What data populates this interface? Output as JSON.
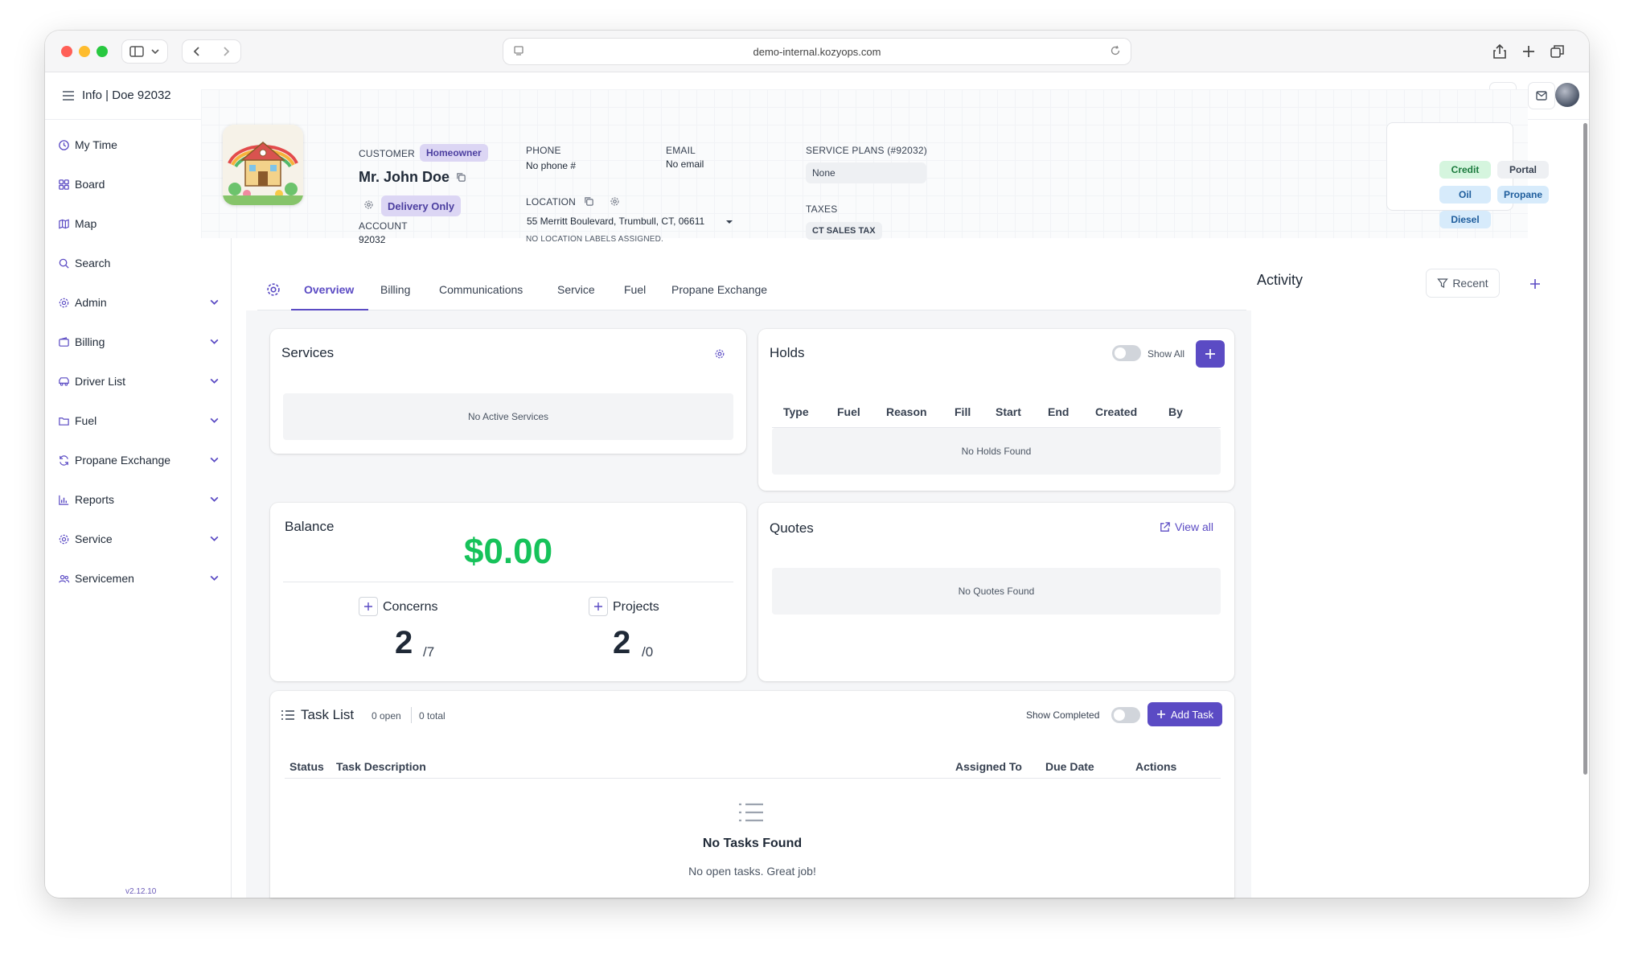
{
  "browser": {
    "url": "demo-internal.kozyops.com"
  },
  "topbar": {
    "breadcrumb": "Info | Doe 92032"
  },
  "sidebar": {
    "items": [
      {
        "label": "My Time",
        "icon": "clock-icon",
        "expandable": false
      },
      {
        "label": "Board",
        "icon": "grid-icon",
        "expandable": false
      },
      {
        "label": "Map",
        "icon": "map-icon",
        "expandable": false
      },
      {
        "label": "Search",
        "icon": "search-icon",
        "expandable": false
      },
      {
        "label": "Admin",
        "icon": "gear-icon",
        "expandable": true
      },
      {
        "label": "Billing",
        "icon": "wallet-icon",
        "expandable": true
      },
      {
        "label": "Driver List",
        "icon": "truck-icon",
        "expandable": true
      },
      {
        "label": "Fuel",
        "icon": "folder-icon",
        "expandable": true
      },
      {
        "label": "Propane Exchange",
        "icon": "refresh-icon",
        "expandable": true
      },
      {
        "label": "Reports",
        "icon": "bar-chart-icon",
        "expandable": true
      },
      {
        "label": "Service",
        "icon": "gear-icon",
        "expandable": true
      },
      {
        "label": "Servicemen",
        "icon": "users-icon",
        "expandable": true
      }
    ],
    "version": "v2.12.10"
  },
  "customer": {
    "label": "CUSTOMER",
    "type_badge": "Homeowner",
    "name": "Mr. John Doe",
    "delivery_badge": "Delivery Only",
    "account_label": "ACCOUNT",
    "account": "92032",
    "phone_label": "PHONE",
    "phone": "No phone #",
    "email_label": "EMAIL",
    "email": "No email",
    "location_label": "LOCATION",
    "location": "55 Merritt Boulevard, Trumbull, CT, 06611",
    "location_note": "NO LOCATION LABELS ASSIGNED.",
    "service_plans_label": "SERVICE PLANS (#92032)",
    "service_plans": "None",
    "taxes_label": "TAXES",
    "tax": "CT SALES TAX"
  },
  "tags": [
    "Credit",
    "Portal",
    "Oil",
    "Propane",
    "Diesel"
  ],
  "tabs": [
    "Overview",
    "Billing",
    "Communications",
    "Service",
    "Fuel",
    "Propane Exchange"
  ],
  "activity": {
    "title": "Activity",
    "filter_label": "Recent"
  },
  "services": {
    "title": "Services",
    "empty": "No Active Services"
  },
  "holds": {
    "title": "Holds",
    "show_all": "Show All",
    "columns": [
      "Type",
      "Fuel",
      "Reason",
      "Fill",
      "Start",
      "End",
      "Created",
      "By"
    ],
    "empty": "No Holds Found"
  },
  "balance": {
    "title": "Balance",
    "amount": "$0.00",
    "concerns_label": "Concerns",
    "concerns_open": "2",
    "concerns_total": "/7",
    "projects_label": "Projects",
    "projects_open": "2",
    "projects_total": "/0"
  },
  "quotes": {
    "title": "Quotes",
    "view_all": "View all",
    "empty": "No Quotes Found"
  },
  "tasks": {
    "title": "Task List",
    "open": "0 open",
    "total": "0 total",
    "show_completed": "Show Completed",
    "add_task": "Add Task",
    "columns": [
      "Status",
      "Task Description",
      "Assigned To",
      "Due Date",
      "Actions"
    ],
    "empty_title": "No Tasks Found",
    "empty_sub": "No open tasks. Great job!"
  },
  "colors": {
    "accent": "#5b4bc4",
    "balance": "#16c25a"
  }
}
